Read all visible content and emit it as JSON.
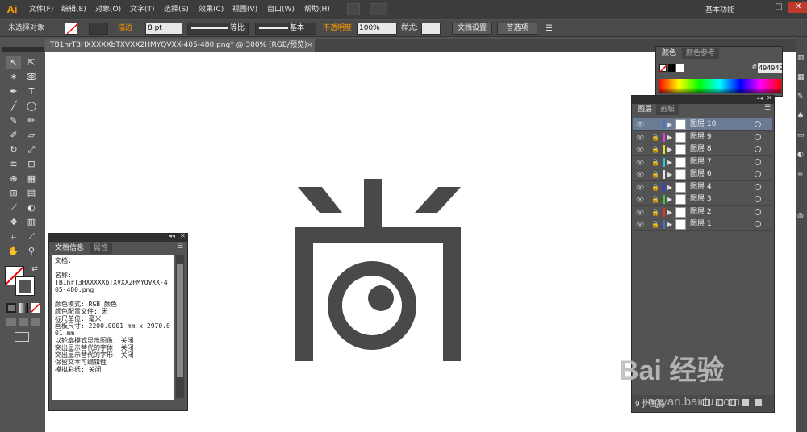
{
  "app": {
    "logo": "Ai",
    "menus": [
      "文件(F)",
      "编辑(E)",
      "对象(O)",
      "文字(T)",
      "选择(S)",
      "效果(C)",
      "视图(V)",
      "窗口(W)",
      "帮助(H)"
    ],
    "workspace": "基本功能",
    "window_controls": [
      "─",
      "□",
      "✕"
    ]
  },
  "control_bar": {
    "selection_label": "未选择对象",
    "stroke_label": "描边",
    "stroke_weight": "8 pt",
    "profile_label": "等比",
    "brush_label": "基本",
    "opacity_label": "不透明度",
    "opacity_value": "100%",
    "style_label": "样式:",
    "doc_setup_button": "文档设置",
    "preferences_button": "首选项"
  },
  "document_tab": {
    "title": "TB1hrT3HXXXXXbTXVXX2HMYQVXX-405-480.png* @ 300% (RGB/预览)",
    "close": "×"
  },
  "doc_info_panel": {
    "tabs": [
      "文档信息",
      "属性"
    ],
    "lines": [
      "文档:",
      "",
      "名称:",
      "TB1hrT3HXXXXXbTXVXX2HMYQVXX-405-480.png",
      "",
      "颜色模式: RGB 颜色",
      "颜色配置文件: 无",
      "标尺单位: 毫米",
      "画板尺寸: 2200.0001 mm x 2970.001 mm",
      "以轮廓模式显示图像: 关闭",
      "突出显示替代的字体: 关闭",
      "突出显示替代的字形: 关闭",
      "保留文本可编辑性",
      "模拟彩纸: 关闭"
    ]
  },
  "color_panel": {
    "tabs": [
      "颜色",
      "颜色参考"
    ],
    "hex_label": "#",
    "hex_value": "494949"
  },
  "layers_panel": {
    "tabs": [
      "图层",
      "画板"
    ],
    "layers": [
      {
        "name": "图层 10",
        "color": "#4a6ed8",
        "selected": true,
        "locked": false
      },
      {
        "name": "图层 9",
        "color": "#e040e0",
        "selected": false,
        "locked": true
      },
      {
        "name": "图层 8",
        "color": "#e8e020",
        "selected": false,
        "locked": true
      },
      {
        "name": "图层 7",
        "color": "#30c8e8",
        "selected": false,
        "locked": true
      },
      {
        "name": "图层 6",
        "color": "#e8e8e8",
        "selected": false,
        "locked": true
      },
      {
        "name": "图层 4",
        "color": "#3040e0",
        "selected": false,
        "locked": true
      },
      {
        "name": "图层 3",
        "color": "#30d830",
        "selected": false,
        "locked": true
      },
      {
        "name": "图层 2",
        "color": "#e83030",
        "selected": false,
        "locked": true
      },
      {
        "name": "图层 1",
        "color": "#4a6ed8",
        "selected": false,
        "locked": true
      }
    ],
    "footer_count": "9 个图层"
  },
  "artwork": {
    "fill_color": "#494949"
  },
  "watermark": {
    "main": "Bai 经验",
    "sub": "jingyan.baidu.com"
  },
  "colors": {
    "accent_orange": "#ff9a00",
    "selection_blue": "#6a7c94"
  }
}
